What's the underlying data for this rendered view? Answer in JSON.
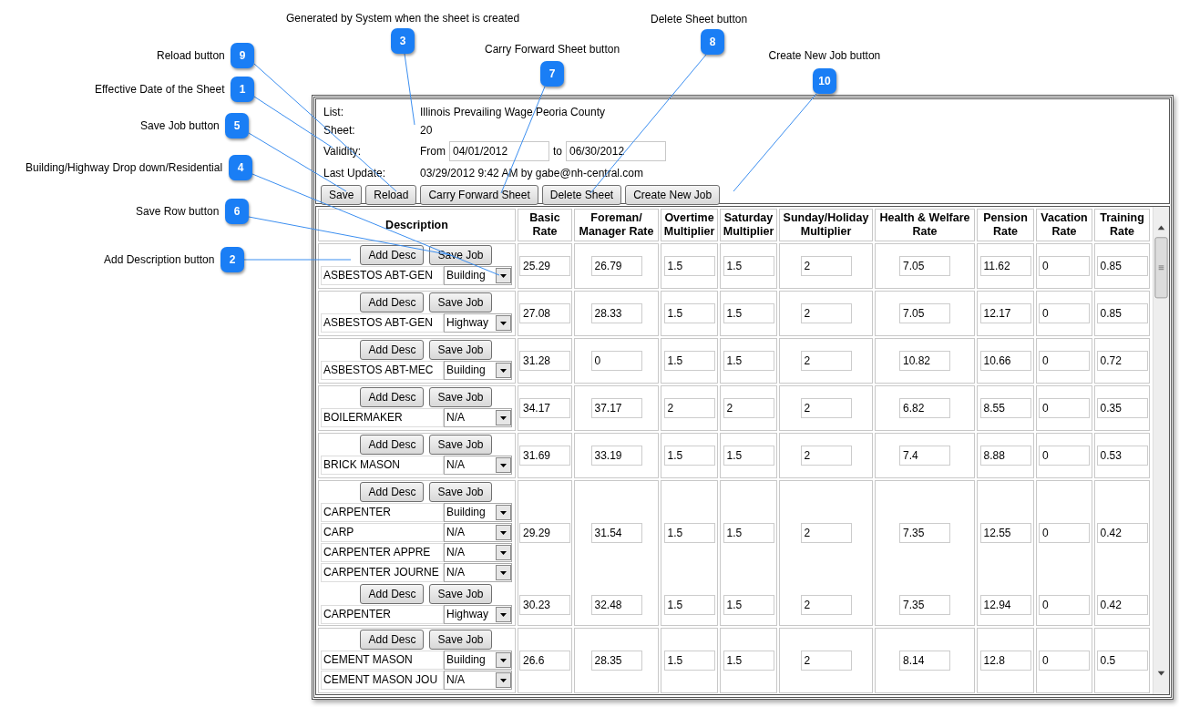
{
  "callouts": [
    {
      "number": "3",
      "text": "Generated by System when the sheet is created"
    },
    {
      "number": "8",
      "text": "Delete Sheet button"
    },
    {
      "number": "7",
      "text": "Carry Forward Sheet button"
    },
    {
      "number": "9",
      "text": "Reload button"
    },
    {
      "number": "10",
      "text": "Create New Job button"
    },
    {
      "number": "1",
      "text": "Effective Date of the Sheet"
    },
    {
      "number": "5",
      "text": "Save Job button"
    },
    {
      "number": "4",
      "text": "Building/Highway Drop down/Residential"
    },
    {
      "number": "6",
      "text": "Save Row button"
    },
    {
      "number": "2",
      "text": "Add Description button"
    }
  ],
  "sheet": {
    "fields": [
      {
        "label": "List:",
        "value": "Illinois Prevailing Wage Peoria County"
      },
      {
        "label": "Sheet:",
        "value": "20"
      }
    ],
    "validity": {
      "label": "Validity:",
      "from_label": "From",
      "from": "04/01/2012",
      "to_label": "to",
      "to": "06/30/2012"
    },
    "last_update": {
      "label": "Last Update:",
      "value": "03/29/2012 9:42 AM by gabe@nh-central.com"
    },
    "buttons": [
      "Save",
      "Reload",
      "Carry Forward Sheet",
      "Delete Sheet",
      "Create New Job"
    ]
  },
  "table": {
    "columns": [
      "Description",
      "Basic Rate",
      "Foreman/ Manager Rate",
      "Overtime Multiplier",
      "Saturday Multiplier",
      "Sunday/Holiday Multiplier",
      "Health & Welfare Rate",
      "Pension Rate",
      "Vacation Rate",
      "Training Rate"
    ],
    "rows": [
      {
        "jobs": [
          {
            "buttons": [
              "Add Desc",
              "Save Job"
            ],
            "descriptions": [
              {
                "name": "ASBESTOS ABT-GEN",
                "type": "Building"
              }
            ],
            "rates": [
              "25.29",
              "26.79",
              "1.5",
              "1.5",
              "2",
              "7.05",
              "11.62",
              "0",
              "0.85"
            ]
          }
        ]
      },
      {
        "jobs": [
          {
            "buttons": [
              "Add Desc",
              "Save Job"
            ],
            "descriptions": [
              {
                "name": "ASBESTOS ABT-GEN",
                "type": "Highway"
              }
            ],
            "rates": [
              "27.08",
              "28.33",
              "1.5",
              "1.5",
              "2",
              "7.05",
              "12.17",
              "0",
              "0.85"
            ]
          }
        ]
      },
      {
        "jobs": [
          {
            "buttons": [
              "Add Desc",
              "Save Job"
            ],
            "descriptions": [
              {
                "name": "ASBESTOS ABT-MEC",
                "type": "Building"
              }
            ],
            "rates": [
              "31.28",
              "0",
              "1.5",
              "1.5",
              "2",
              "10.82",
              "10.66",
              "0",
              "0.72"
            ]
          }
        ]
      },
      {
        "jobs": [
          {
            "buttons": [
              "Add Desc",
              "Save Job"
            ],
            "descriptions": [
              {
                "name": "BOILERMAKER",
                "type": "N/A"
              }
            ],
            "rates": [
              "34.17",
              "37.17",
              "2",
              "2",
              "2",
              "6.82",
              "8.55",
              "0",
              "0.35"
            ]
          }
        ]
      },
      {
        "jobs": [
          {
            "buttons": [
              "Add Desc",
              "Save Job"
            ],
            "descriptions": [
              {
                "name": "BRICK MASON",
                "type": "N/A"
              }
            ],
            "rates": [
              "31.69",
              "33.19",
              "1.5",
              "1.5",
              "2",
              "7.4",
              "8.88",
              "0",
              "0.53"
            ]
          }
        ]
      },
      {
        "jobs": [
          {
            "buttons": [
              "Add Desc",
              "Save Job"
            ],
            "descriptions": [
              {
                "name": "CARPENTER",
                "type": "Building"
              },
              {
                "name": "CARP",
                "type": "N/A"
              },
              {
                "name": "CARPENTER APPRE",
                "type": "N/A"
              },
              {
                "name": "CARPENTER JOURNE",
                "type": "N/A"
              }
            ],
            "rates": [
              "29.29",
              "31.54",
              "1.5",
              "1.5",
              "2",
              "7.35",
              "12.55",
              "0",
              "0.42"
            ]
          },
          {
            "buttons": [
              "Add Desc",
              "Save Job"
            ],
            "descriptions": [
              {
                "name": "CARPENTER",
                "type": "Highway"
              }
            ],
            "rates": [
              "30.23",
              "32.48",
              "1.5",
              "1.5",
              "2",
              "7.35",
              "12.94",
              "0",
              "0.42"
            ]
          }
        ]
      },
      {
        "jobs": [
          {
            "buttons": [
              "Add Desc",
              "Save Job"
            ],
            "descriptions": [
              {
                "name": "CEMENT MASON",
                "type": "Building"
              },
              {
                "name": "CEMENT MASON JOU",
                "type": "N/A"
              }
            ],
            "rates": [
              "26.6",
              "28.35",
              "1.5",
              "1.5",
              "2",
              "8.14",
              "12.8",
              "0",
              "0.5"
            ]
          }
        ]
      }
    ]
  }
}
